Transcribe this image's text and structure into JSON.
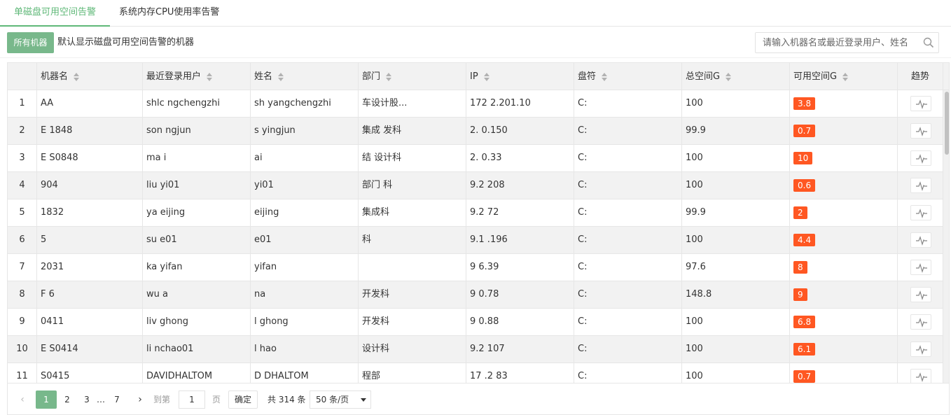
{
  "tabs": [
    {
      "label": "单磁盘可用空间告警",
      "active": true
    },
    {
      "label": "系统内存CPU使用率告警",
      "active": false
    }
  ],
  "toolbar": {
    "all_machines_label": "所有机器",
    "hint": "默认显示磁盘可用空间告警的机器",
    "search_placeholder": "请输入机器名或最近登录用户、姓名"
  },
  "table": {
    "columns": [
      "",
      "机器名",
      "最近登录用户",
      "姓名",
      "部门",
      "IP",
      "盘符",
      "总空间G",
      "可用空间G",
      "趋势"
    ],
    "rows": [
      {
        "n": "1",
        "machine": "AA",
        "user": "shlc  ngchengzhi",
        "name": "sh  yangchengzhi",
        "dept": "车设计股...",
        "ip": "172  2.201.10",
        "drive": "C:",
        "total": "100",
        "free": "3.8"
      },
      {
        "n": "2",
        "machine": "E  1848",
        "user": "son  ngjun",
        "name": "s  yingjun",
        "dept": "  集成  发科",
        "ip": "2.  0.150",
        "drive": "C:",
        "total": "99.9",
        "free": "0.7"
      },
      {
        "n": "3",
        "machine": "E  S0848",
        "user": "ma  i",
        "name": "ai",
        "dept": "  结  设计科",
        "ip": "2.  0.33",
        "drive": "C:",
        "total": "100",
        "free": "10"
      },
      {
        "n": "4",
        "machine": "904",
        "user": "liu  yi01",
        "name": "  yi01",
        "dept": "部门  科",
        "ip": "9.2  208",
        "drive": "C:",
        "total": "100",
        "free": "0.6"
      },
      {
        "n": "5",
        "machine": "1832",
        "user": "ya  eijing",
        "name": "  eijing",
        "dept": "  集成科",
        "ip": "9.2  72",
        "drive": "C:",
        "total": "99.9",
        "free": "2"
      },
      {
        "n": "6",
        "machine": "5",
        "user": "su  e01",
        "name": "  e01",
        "dept": "科",
        "ip": "9.1  .196",
        "drive": "C:",
        "total": "100",
        "free": "4.4"
      },
      {
        "n": "7",
        "machine": "2031",
        "user": "ka  yifan",
        "name": "  yifan",
        "dept": "",
        "ip": "9  6.39",
        "drive": "C:",
        "total": "97.6",
        "free": "8"
      },
      {
        "n": "8",
        "machine": "F  6",
        "user": "wu  a",
        "name": "  na",
        "dept": "  开发科",
        "ip": "9  0.78",
        "drive": "C:",
        "total": "148.8",
        "free": "9"
      },
      {
        "n": "9",
        "machine": "0411",
        "user": "liv  ghong",
        "name": "l  ghong",
        "dept": "  开发科",
        "ip": "9  0.88",
        "drive": "C:",
        "total": "100",
        "free": "6.8"
      },
      {
        "n": "10",
        "machine": "E  S0414",
        "user": "li  nchao01",
        "name": "l  hao",
        "dept": "  设计科",
        "ip": "9.2  107",
        "drive": "C:",
        "total": "100",
        "free": "6.1"
      },
      {
        "n": "11",
        "machine": "S0415",
        "user": "DAVIDHALTOM",
        "name": "D  DHALTOM",
        "dept": "  程部",
        "ip": "17  .2  83",
        "drive": "C:",
        "total": "100",
        "free": "0.7"
      }
    ]
  },
  "pager": {
    "prev": "‹",
    "next": "›",
    "pages": [
      "1",
      "2",
      "3"
    ],
    "ellipsis": "…",
    "last": "7",
    "goto_label": "到第",
    "goto_value": "1",
    "page_unit": "页",
    "confirm": "确定",
    "total": "共 314 条",
    "per_page": "50 条/页"
  },
  "colors": {
    "accent": "#5fb878",
    "button": "#78b88b",
    "badge": "#ff5722"
  }
}
